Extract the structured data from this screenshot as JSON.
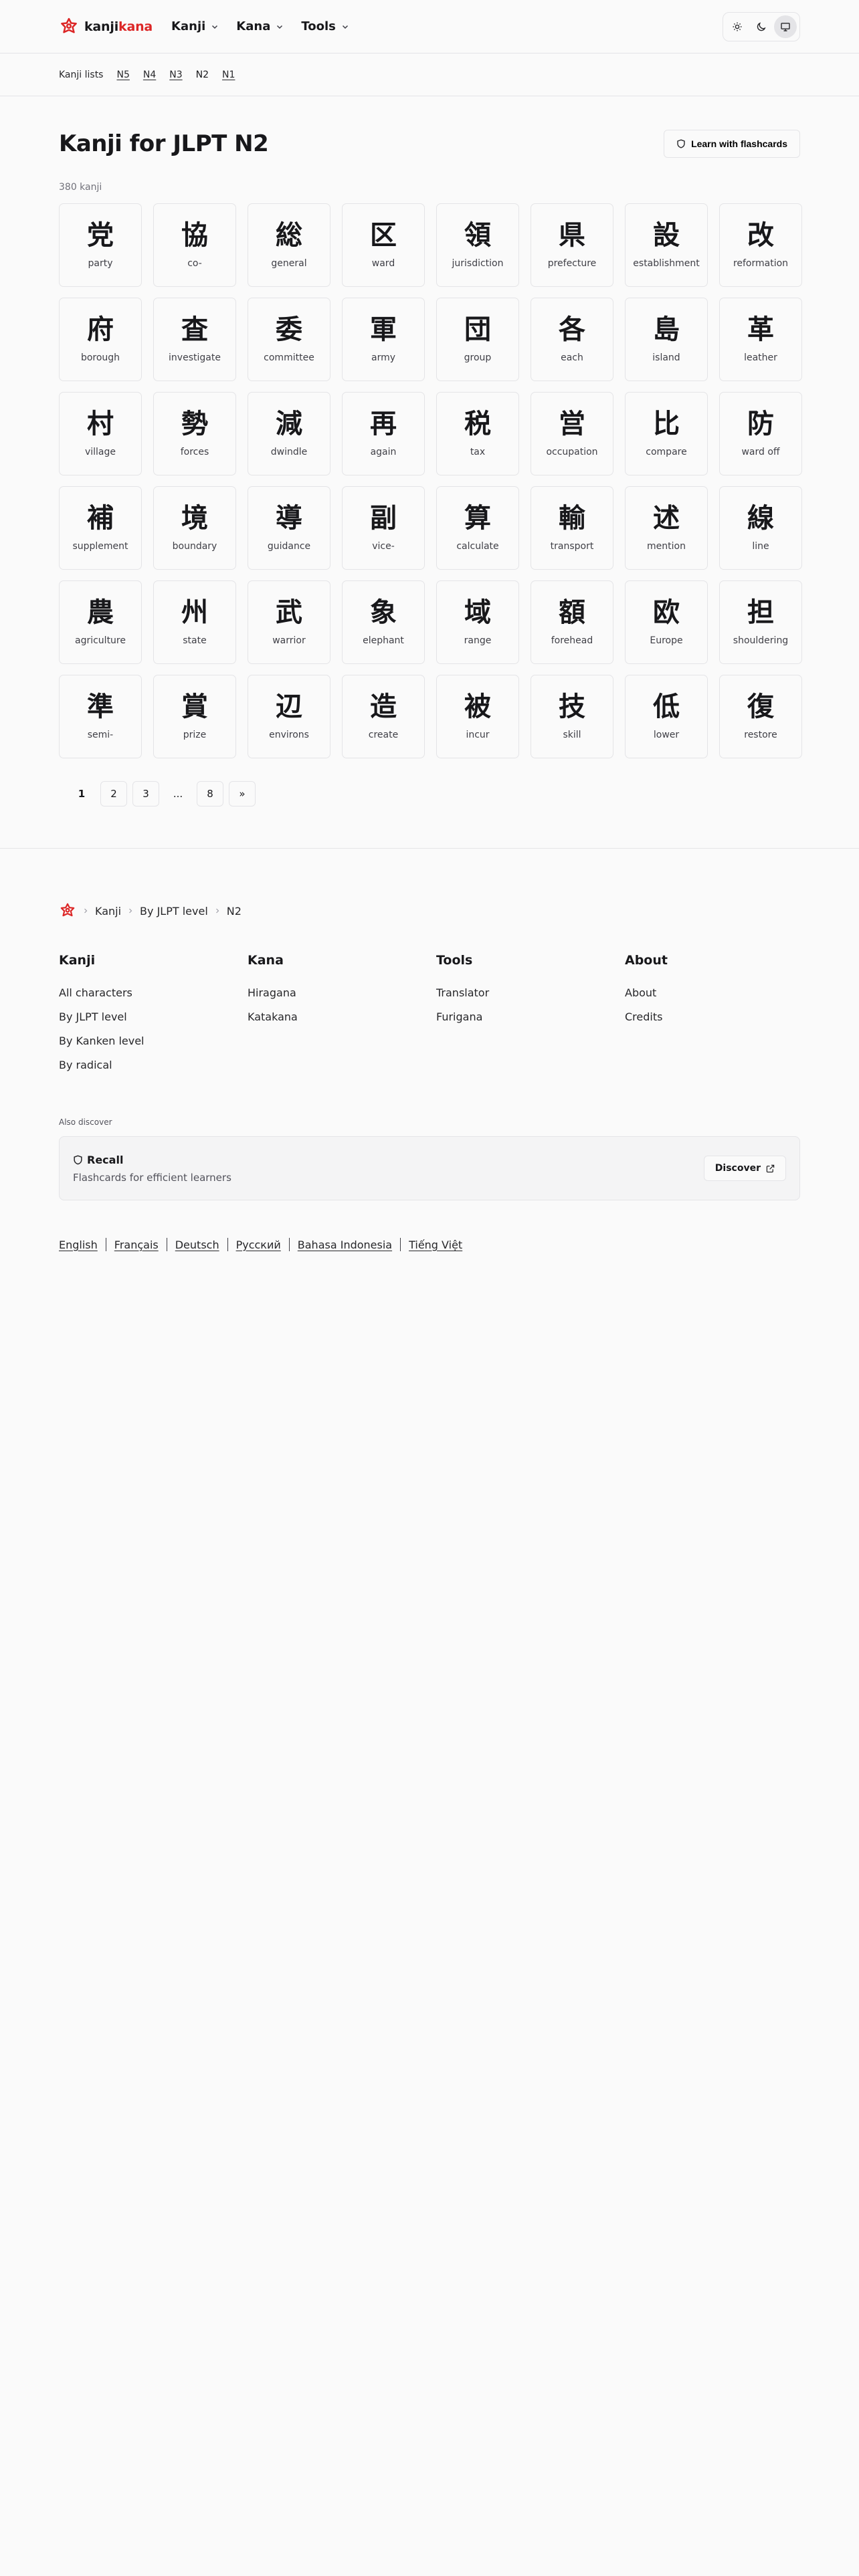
{
  "header": {
    "logo_kanji": "kanji",
    "logo_kana": "kana",
    "nav": [
      {
        "label": "Kanji"
      },
      {
        "label": "Kana"
      },
      {
        "label": "Tools"
      }
    ],
    "theme_options": [
      "light",
      "dark",
      "system"
    ],
    "theme_selected": "system"
  },
  "subnav": {
    "label": "Kanji lists",
    "levels": [
      {
        "label": "N5",
        "current": false
      },
      {
        "label": "N4",
        "current": false
      },
      {
        "label": "N3",
        "current": false
      },
      {
        "label": "N2",
        "current": true
      },
      {
        "label": "N1",
        "current": false
      }
    ]
  },
  "main": {
    "title": "Kanji for JLPT N2",
    "flashcards_label": "Learn with flashcards",
    "count": "380 kanji",
    "kanji": [
      {
        "char": "党",
        "meaning": "party"
      },
      {
        "char": "協",
        "meaning": "co-"
      },
      {
        "char": "総",
        "meaning": "general"
      },
      {
        "char": "区",
        "meaning": "ward"
      },
      {
        "char": "領",
        "meaning": "jurisdiction"
      },
      {
        "char": "県",
        "meaning": "prefecture"
      },
      {
        "char": "設",
        "meaning": "establishment"
      },
      {
        "char": "改",
        "meaning": "reformation"
      },
      {
        "char": "府",
        "meaning": "borough"
      },
      {
        "char": "査",
        "meaning": "investigate"
      },
      {
        "char": "委",
        "meaning": "committee"
      },
      {
        "char": "軍",
        "meaning": "army"
      },
      {
        "char": "団",
        "meaning": "group"
      },
      {
        "char": "各",
        "meaning": "each"
      },
      {
        "char": "島",
        "meaning": "island"
      },
      {
        "char": "革",
        "meaning": "leather"
      },
      {
        "char": "村",
        "meaning": "village"
      },
      {
        "char": "勢",
        "meaning": "forces"
      },
      {
        "char": "減",
        "meaning": "dwindle"
      },
      {
        "char": "再",
        "meaning": "again"
      },
      {
        "char": "税",
        "meaning": "tax"
      },
      {
        "char": "営",
        "meaning": "occupation"
      },
      {
        "char": "比",
        "meaning": "compare"
      },
      {
        "char": "防",
        "meaning": "ward off"
      },
      {
        "char": "補",
        "meaning": "supplement"
      },
      {
        "char": "境",
        "meaning": "boundary"
      },
      {
        "char": "導",
        "meaning": "guidance"
      },
      {
        "char": "副",
        "meaning": "vice-"
      },
      {
        "char": "算",
        "meaning": "calculate"
      },
      {
        "char": "輸",
        "meaning": "transport"
      },
      {
        "char": "述",
        "meaning": "mention"
      },
      {
        "char": "線",
        "meaning": "line"
      },
      {
        "char": "農",
        "meaning": "agriculture"
      },
      {
        "char": "州",
        "meaning": "state"
      },
      {
        "char": "武",
        "meaning": "warrior"
      },
      {
        "char": "象",
        "meaning": "elephant"
      },
      {
        "char": "域",
        "meaning": "range"
      },
      {
        "char": "額",
        "meaning": "forehead"
      },
      {
        "char": "欧",
        "meaning": "Europe"
      },
      {
        "char": "担",
        "meaning": "shouldering"
      },
      {
        "char": "準",
        "meaning": "semi-"
      },
      {
        "char": "賞",
        "meaning": "prize"
      },
      {
        "char": "辺",
        "meaning": "environs"
      },
      {
        "char": "造",
        "meaning": "create"
      },
      {
        "char": "被",
        "meaning": "incur"
      },
      {
        "char": "技",
        "meaning": "skill"
      },
      {
        "char": "低",
        "meaning": "lower"
      },
      {
        "char": "復",
        "meaning": "restore"
      }
    ],
    "pagination": [
      {
        "label": "1",
        "type": "current"
      },
      {
        "label": "2",
        "type": "page"
      },
      {
        "label": "3",
        "type": "page"
      },
      {
        "label": "...",
        "type": "ellipsis"
      },
      {
        "label": "8",
        "type": "page"
      },
      {
        "label": "»",
        "type": "page"
      }
    ]
  },
  "footer": {
    "breadcrumb": [
      "Kanji",
      "By JLPT level",
      "N2"
    ],
    "columns": [
      {
        "title": "Kanji",
        "links": [
          "All characters",
          "By JLPT level",
          "By Kanken level",
          "By radical"
        ]
      },
      {
        "title": "Kana",
        "links": [
          "Hiragana",
          "Katakana"
        ]
      },
      {
        "title": "Tools",
        "links": [
          "Translator",
          "Furigana"
        ]
      },
      {
        "title": "About",
        "links": [
          "About",
          "Credits"
        ]
      }
    ],
    "also_discover": "Also discover",
    "recall": {
      "title": "Recall",
      "subtitle": "Flashcards for efficient learners",
      "button": "Discover"
    },
    "languages": [
      "English",
      "Français",
      "Deutsch",
      "Русский",
      "Bahasa Indonesia",
      "Tiếng Việt"
    ]
  },
  "colors": {
    "accent": "#dc2626",
    "background": "#fafafa",
    "border": "#e4e4e7"
  }
}
